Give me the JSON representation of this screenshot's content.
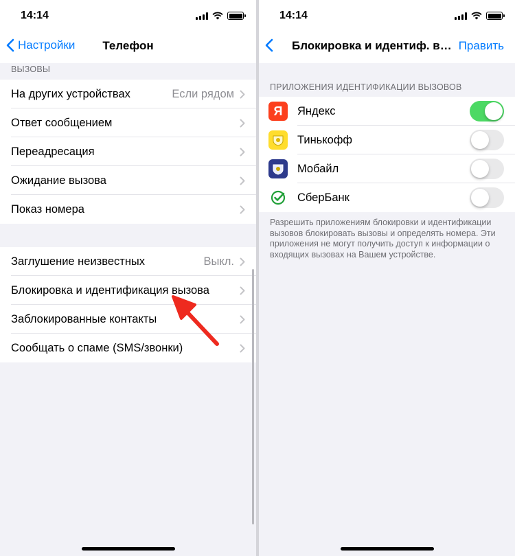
{
  "left": {
    "status": {
      "time": "14:14"
    },
    "nav": {
      "back_label": "Настройки",
      "title": "Телефон"
    },
    "calls_section": {
      "header": "ВЫЗОВЫ"
    },
    "group1": [
      {
        "label": "На других устройствах",
        "value": "Если рядом"
      },
      {
        "label": "Ответ сообщением",
        "value": ""
      },
      {
        "label": "Переадресация",
        "value": ""
      },
      {
        "label": "Ожидание вызова",
        "value": ""
      },
      {
        "label": "Показ номера",
        "value": ""
      }
    ],
    "group2": [
      {
        "label": "Заглушение неизвестных",
        "value": "Выкл."
      },
      {
        "label": "Блокировка и идентификация вызова",
        "value": ""
      },
      {
        "label": "Заблокированные контакты",
        "value": ""
      },
      {
        "label": "Сообщать о спаме (SMS/звонки)",
        "value": ""
      }
    ]
  },
  "right": {
    "status": {
      "time": "14:14"
    },
    "nav": {
      "title": "Блокировка и идентиф. выз...",
      "edit_label": "Править"
    },
    "section": {
      "header": "ПРИЛОЖЕНИЯ ИДЕНТИФИКАЦИИ ВЫЗОВОВ"
    },
    "apps": [
      {
        "name": "Яндекс",
        "icon": "yandex-icon",
        "enabled": true
      },
      {
        "name": "Тинькофф",
        "icon": "tinkoff-icon",
        "enabled": false
      },
      {
        "name": "Мобайл",
        "icon": "mobile-icon",
        "enabled": false
      },
      {
        "name": "СберБанк",
        "icon": "sberbank-icon",
        "enabled": false
      }
    ],
    "footer": "Разрешить приложениям блокировки и идентификации вызовов блокировать вызовы и определять номера. Эти приложения не могут получить доступ к информации о входящих вызовах на Вашем устройстве."
  },
  "colors": {
    "accent": "#007aff",
    "toggle_on": "#4cd964",
    "arrow": "#ee2a1f",
    "yandex": "#fc3f1d",
    "tinkoff": "#ffdd2d",
    "sber": "#21a038"
  }
}
